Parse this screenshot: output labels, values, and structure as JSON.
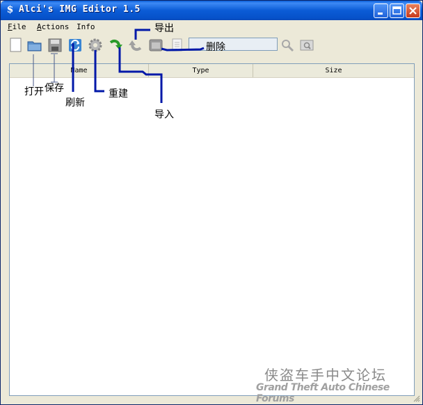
{
  "window": {
    "title": "Alci's IMG Editor 1.5"
  },
  "menu": {
    "file": "File",
    "actions": "Actions",
    "info": "Info"
  },
  "columns": {
    "name": "Name",
    "type": "Type",
    "size": "Size"
  },
  "annotations": {
    "open": "打开",
    "save": "保存",
    "refresh": "刷新",
    "rebuild": "重建",
    "export": "导出",
    "import": "导入",
    "delete": "删除"
  },
  "watermark": {
    "cn": "侠盗车手中文论坛",
    "en": "Grand Theft Auto Chinese Forums"
  },
  "colors": {
    "titlebar": "#0b5cd6",
    "annotation_line": "#0018a8",
    "window_bg": "#ece9d8"
  }
}
